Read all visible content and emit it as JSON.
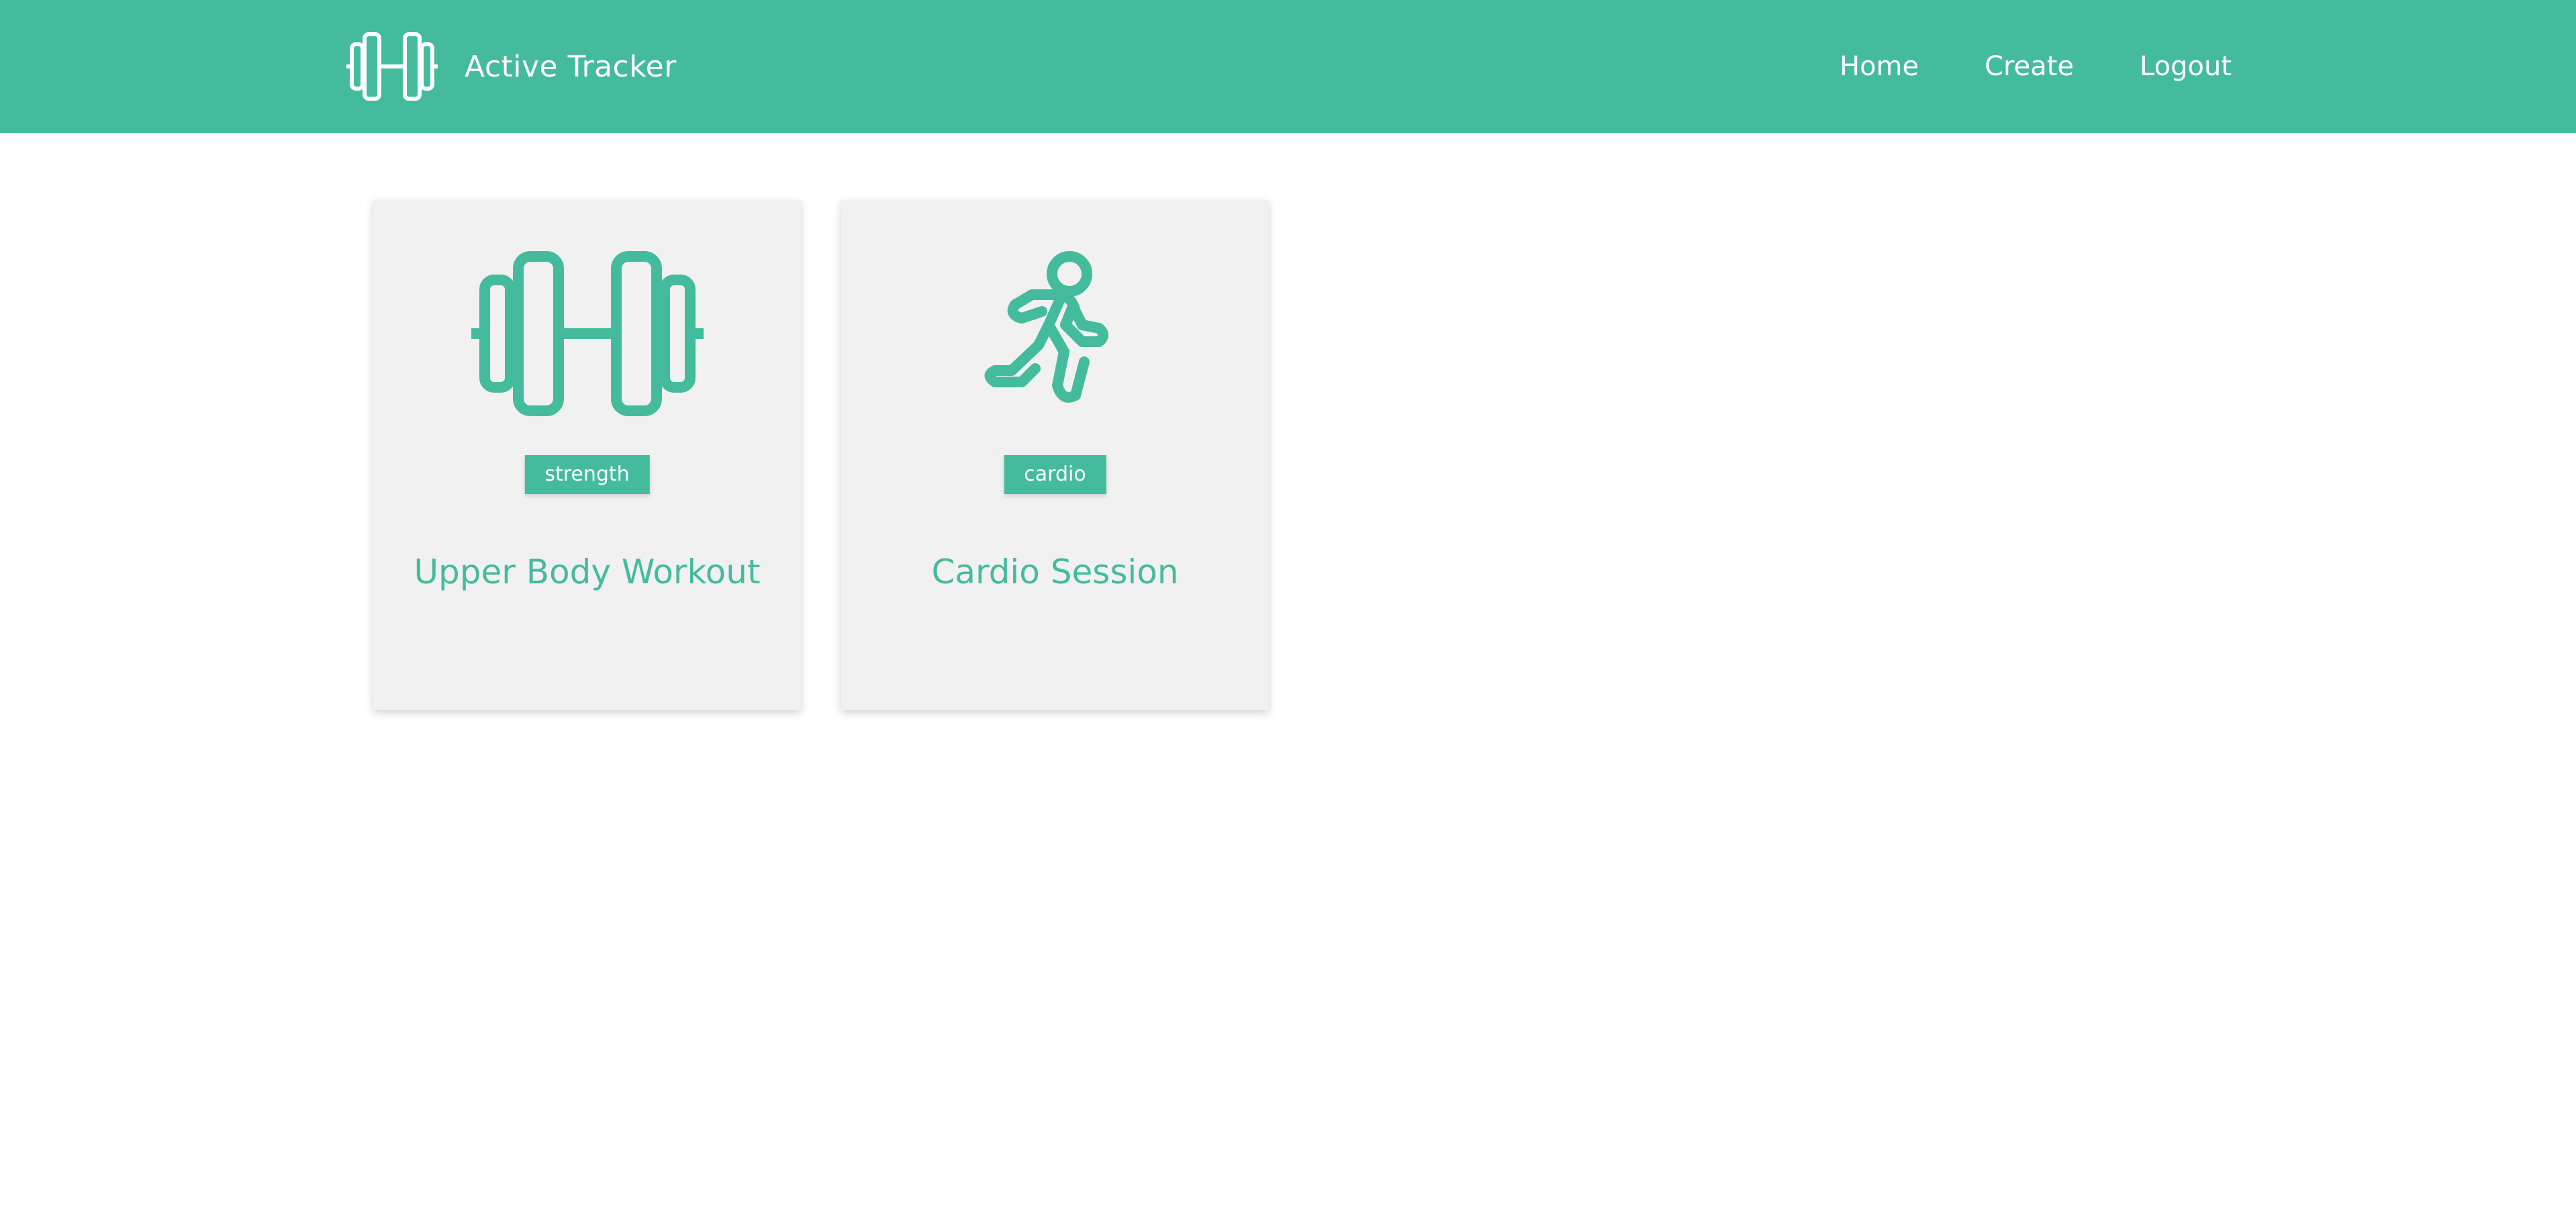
{
  "app": {
    "title": "Active Tracker",
    "logo_icon": "dumbbell-icon"
  },
  "nav": {
    "links": [
      {
        "label": "Home"
      },
      {
        "label": "Create"
      },
      {
        "label": "Logout"
      }
    ]
  },
  "workouts": [
    {
      "icon": "dumbbell-icon",
      "badge": "strength",
      "title": "Upper Body Workout"
    },
    {
      "icon": "running-person-icon",
      "badge": "cardio",
      "title": "Cardio Session"
    }
  ],
  "colors": {
    "accent": "#45bb9d",
    "card_background": "#f1f1f1",
    "page_background": "#ffffff"
  }
}
